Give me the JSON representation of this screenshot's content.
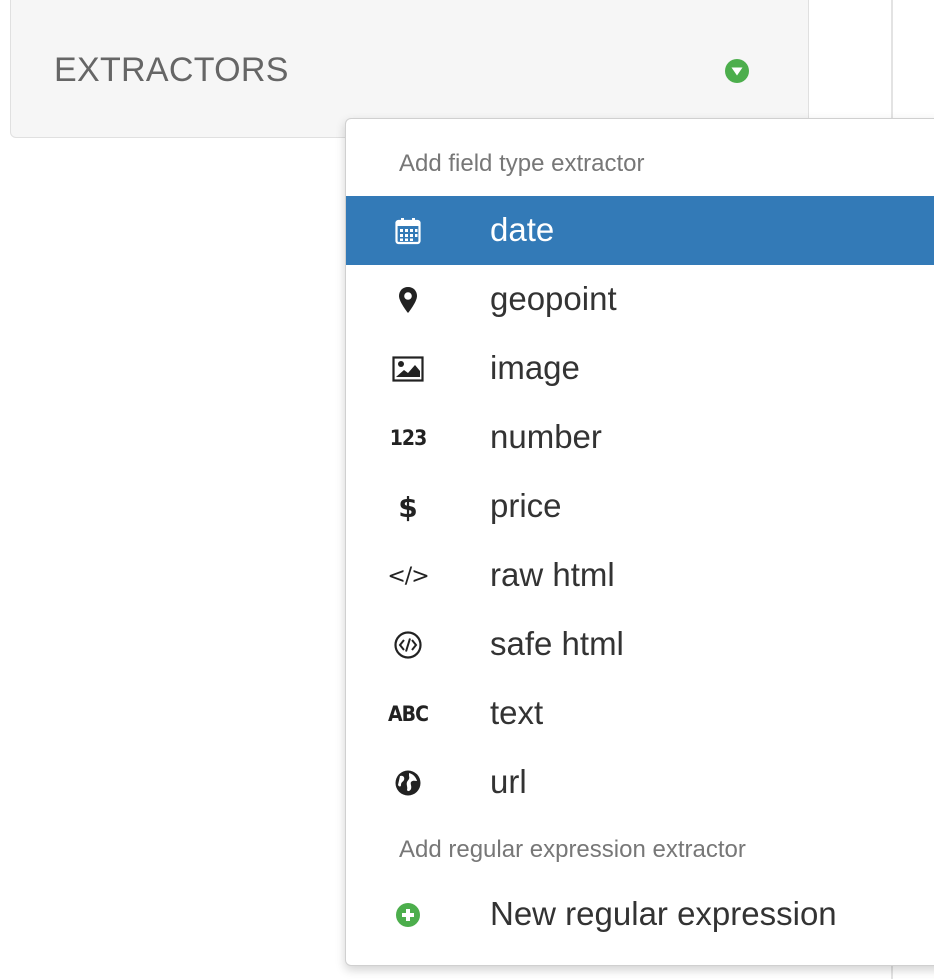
{
  "panel": {
    "title": "EXTRACTORS",
    "toggle_icon": "caret-down-circle-icon",
    "accent_color": "#4cae4c"
  },
  "dropdown": {
    "field_header": "Add field type extractor",
    "items": [
      {
        "label": "date",
        "icon": "calendar-icon",
        "active": true
      },
      {
        "label": "geopoint",
        "icon": "map-marker-icon",
        "active": false
      },
      {
        "label": "image",
        "icon": "picture-icon",
        "active": false
      },
      {
        "label": "number",
        "icon": "number-icon",
        "icon_text": "123",
        "active": false
      },
      {
        "label": "price",
        "icon": "dollar-icon",
        "icon_text": "$",
        "active": false
      },
      {
        "label": "raw html",
        "icon": "code-icon",
        "icon_text": "</>",
        "active": false
      },
      {
        "label": "safe html",
        "icon": "safe-code-icon",
        "active": false
      },
      {
        "label": "text",
        "icon": "text-icon",
        "icon_text": "ABC",
        "active": false
      },
      {
        "label": "url",
        "icon": "globe-icon",
        "active": false
      }
    ],
    "regex_header": "Add regular expression extractor",
    "regex_item": {
      "label": "New regular expression",
      "icon": "plus-circle-icon"
    },
    "active_color": "#337ab7"
  }
}
